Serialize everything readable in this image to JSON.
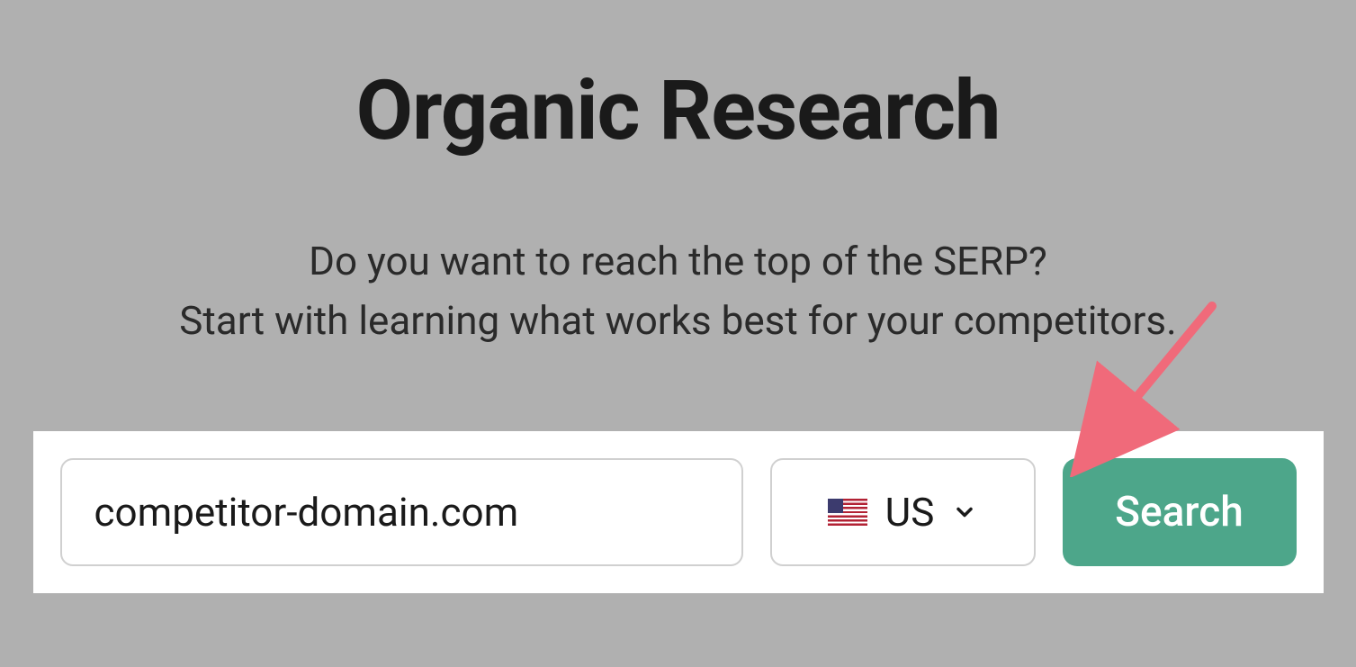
{
  "header": {
    "title": "Organic Research",
    "subtitle_line1": "Do you want to reach the top of the SERP?",
    "subtitle_line2": "Start with learning what works best for your competitors."
  },
  "search": {
    "domain_value": "competitor-domain.com",
    "country_label": "US",
    "country_flag": "us-flag",
    "button_label": "Search"
  },
  "colors": {
    "accent": "#4da68a",
    "background": "#b0b0b0",
    "panel": "#ffffff"
  }
}
